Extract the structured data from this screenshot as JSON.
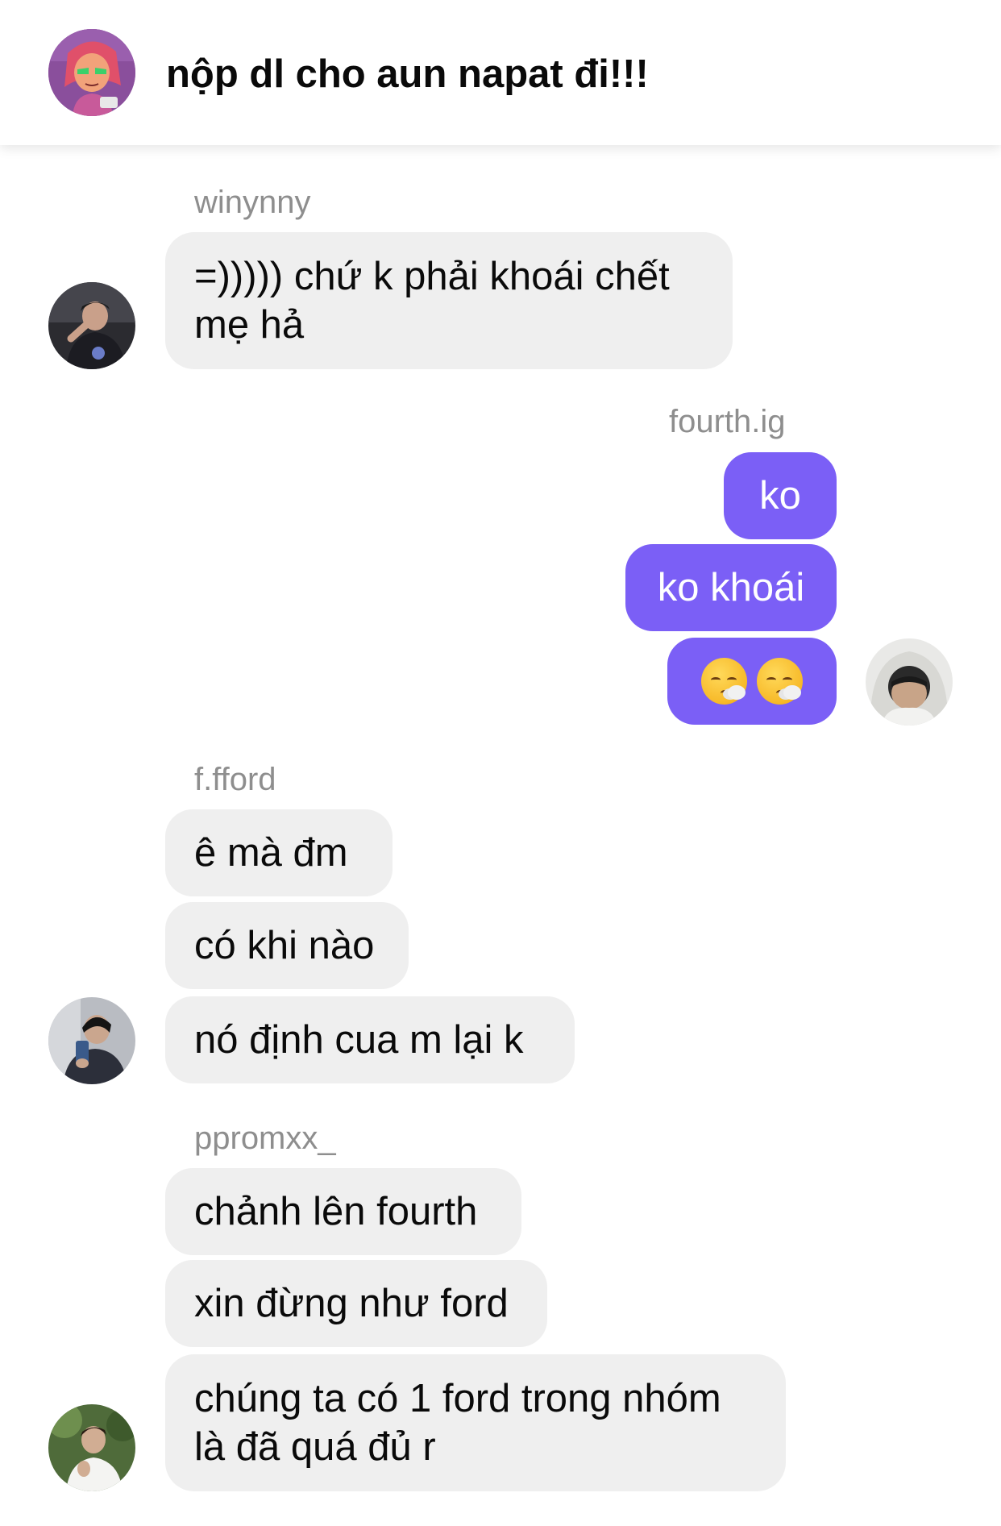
{
  "header": {
    "title": "nộp dl cho aun napat đi!!!",
    "avatar_icon": "group-avatar-icon"
  },
  "messages": [
    {
      "sender": "winynny",
      "direction": "incoming",
      "bubbles": [
        "=))))) chứ k phải khoái chết mẹ hả"
      ]
    },
    {
      "sender": "fourth.ig",
      "direction": "outgoing",
      "bubbles": [
        "ko",
        "ko khoái",
        "😮‍💨😮‍💨"
      ]
    },
    {
      "sender": "f.fford",
      "direction": "incoming",
      "bubbles": [
        "ê mà đm",
        "có khi nào",
        "nó định cua m lại k"
      ]
    },
    {
      "sender": "ppromxx_",
      "direction": "incoming",
      "bubbles": [
        "chảnh lên fourth",
        "xin đừng như ford",
        "chúng ta có 1 ford trong nhóm là đã quá đủ r"
      ]
    }
  ],
  "colors": {
    "outgoing_bubble": "#7b5ff6",
    "incoming_bubble": "#efefef",
    "sender_name": "#8e8e8e"
  }
}
